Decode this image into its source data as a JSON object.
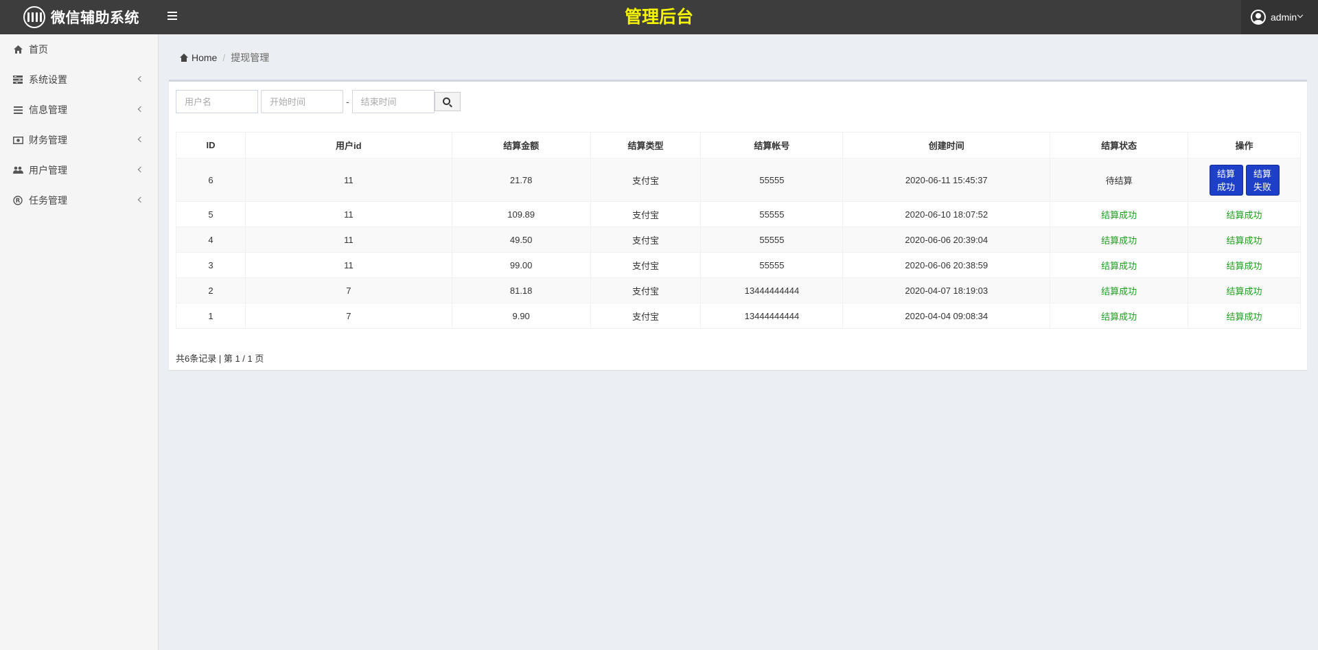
{
  "header": {
    "brand": "微信辅助系统",
    "title": "管理后台",
    "user": "admin"
  },
  "sidebar": {
    "items": [
      {
        "label": "首页",
        "icon": "home-icon"
      },
      {
        "label": "系统设置",
        "icon": "settings-icon"
      },
      {
        "label": "信息管理",
        "icon": "list-icon"
      },
      {
        "label": "财务管理",
        "icon": "money-icon"
      },
      {
        "label": "用户管理",
        "icon": "users-icon"
      },
      {
        "label": "任务管理",
        "icon": "registered-icon"
      }
    ]
  },
  "breadcrumb": {
    "home": "Home",
    "current": "提现管理"
  },
  "search": {
    "username_placeholder": "用户名",
    "start_placeholder": "开始时间",
    "end_placeholder": "结束时间",
    "separator": "-"
  },
  "table": {
    "headers": [
      "ID",
      "用户id",
      "结算金额",
      "结算类型",
      "结算帐号",
      "创建时间",
      "结算状态",
      "操作"
    ],
    "rows": [
      {
        "id": "6",
        "uid": "11",
        "amount": "21.78",
        "type": "支付宝",
        "account": "55555",
        "created": "2020-06-11 15:45:37",
        "status": "待结算",
        "action": ""
      },
      {
        "id": "5",
        "uid": "11",
        "amount": "109.89",
        "type": "支付宝",
        "account": "55555",
        "created": "2020-06-10 18:07:52",
        "status": "结算成功",
        "action": "结算成功"
      },
      {
        "id": "4",
        "uid": "11",
        "amount": "49.50",
        "type": "支付宝",
        "account": "55555",
        "created": "2020-06-06 20:39:04",
        "status": "结算成功",
        "action": "结算成功"
      },
      {
        "id": "3",
        "uid": "11",
        "amount": "99.00",
        "type": "支付宝",
        "account": "55555",
        "created": "2020-06-06 20:38:59",
        "status": "结算成功",
        "action": "结算成功"
      },
      {
        "id": "2",
        "uid": "7",
        "amount": "81.18",
        "type": "支付宝",
        "account": "13444444444",
        "created": "2020-04-07 18:19:03",
        "status": "结算成功",
        "action": "结算成功"
      },
      {
        "id": "1",
        "uid": "7",
        "amount": "9.90",
        "type": "支付宝",
        "account": "13444444444",
        "created": "2020-04-04 09:08:34",
        "status": "结算成功",
        "action": "结算成功"
      }
    ],
    "pending_actions": {
      "success_line1": "结算",
      "success_line2": "成功",
      "fail_line1": "结算",
      "fail_line2": "失败"
    }
  },
  "pager": {
    "text": "共6条记录 | 第 1 / 1 页"
  },
  "colors": {
    "topbar": "#3d3d3d",
    "title": "#f5f500",
    "success": "#1e9e1e",
    "action_button": "#1e40c8"
  }
}
